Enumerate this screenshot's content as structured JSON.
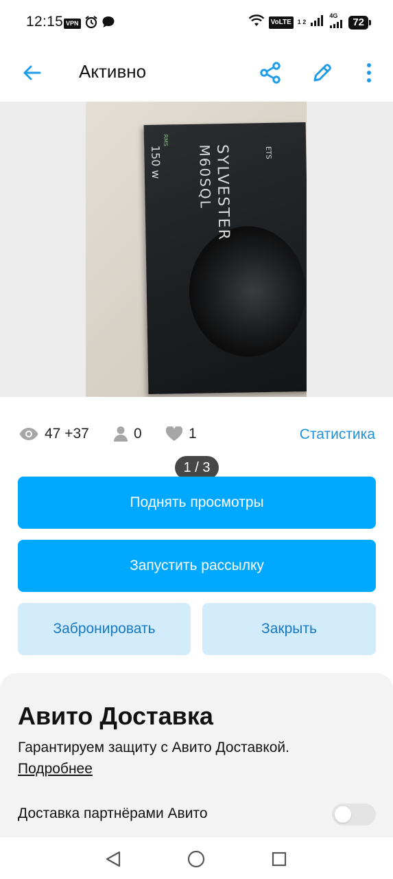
{
  "status_bar": {
    "time": "12:15",
    "vpn": "VPN",
    "volte": "VoLTE",
    "volte_sub": "1 2",
    "network": "4G",
    "battery": "72"
  },
  "app_bar": {
    "title": "Активно",
    "back_icon": "arrow-left-icon",
    "share_icon": "share-icon",
    "edit_icon": "pencil-icon",
    "more_icon": "more-vertical-icon"
  },
  "gallery": {
    "counter": "1 / 3",
    "photo_text": {
      "brand": "SYLVESTER",
      "model": "M60SQL",
      "rms_label": "RMS",
      "rms_value": "150 w",
      "logo": "ETS"
    }
  },
  "stats": {
    "views": "47 +37",
    "contacts": "0",
    "favorites": "1",
    "link": "Статистика"
  },
  "actions": {
    "raise_views": "Поднять просмотры",
    "start_mailing": "Запустить рассылку",
    "reserve": "Забронировать",
    "close": "Закрыть"
  },
  "delivery": {
    "title": "Авито Доставка",
    "description": "Гарантируем защиту с Авито Доставкой.",
    "more_link": "Подробнее",
    "partner_option": "Доставка партнёрами Авито",
    "partner_enabled": false
  },
  "colors": {
    "primary": "#00a9ff",
    "secondary_bg": "#d3ecfc",
    "secondary_text": "#1778c4",
    "link": "#1f8fd9",
    "icon_blue": "#1e9be9"
  }
}
